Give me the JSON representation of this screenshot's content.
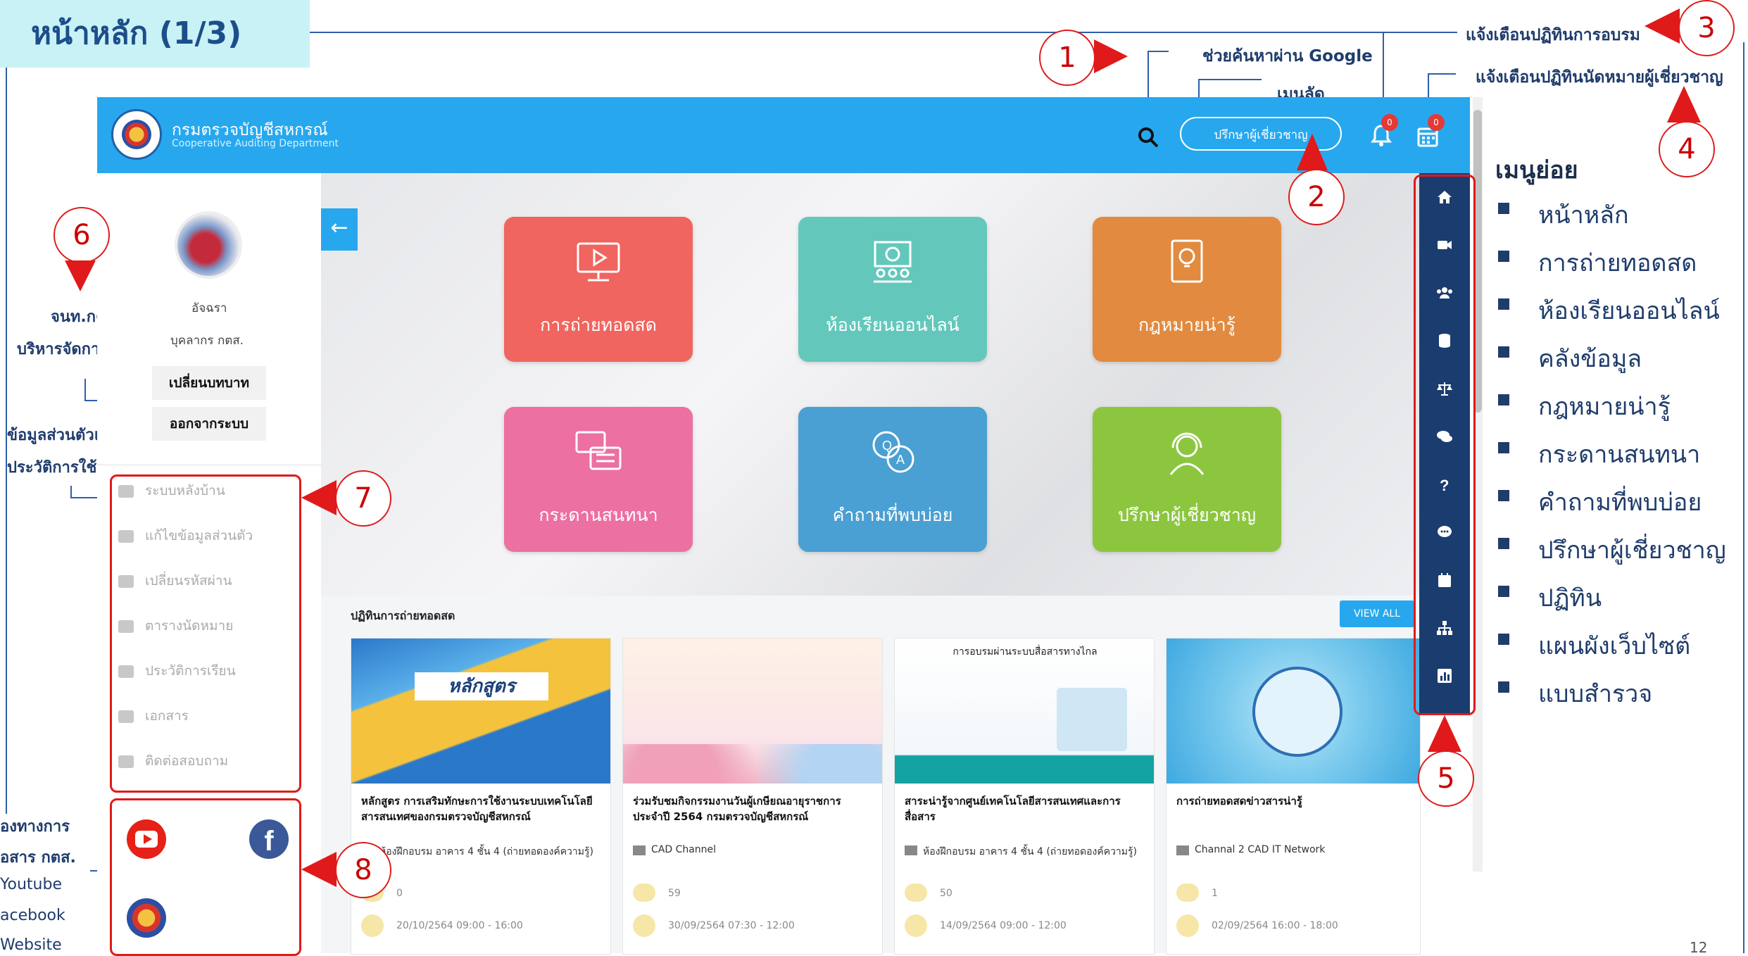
{
  "slide": {
    "title": "หน้าหลัก (1/3)",
    "page_number": "12"
  },
  "annotations": {
    "n1": "1",
    "n2": "2",
    "n3": "3",
    "n4": "4",
    "n5": "5",
    "n6": "6",
    "n7": "7",
    "n8": "8",
    "google_search": "ช่วยค้นหาผ่าน Google",
    "shortcut_menu": "เมนูลัด",
    "training_calendar_alert": "แจ้งเตือนปฏิทินการอบรม",
    "expert_calendar_alert": "แจ้งเตือนปฏิทินนัดหมายผู้เชี่ยวชาญ",
    "staff_line1": "จนท.กตส.",
    "staff_line2": "บริหารจัดการข้อมูล",
    "personal_line1": "ข้อมูลส่วนตัวและ",
    "personal_line2": "ประวัติการใช้งาน",
    "channels_line1": "องทางการ",
    "channels_line2": "อสาร กตส.",
    "channels_line3": "Youtube",
    "channels_line4": "acebook",
    "channels_line5": "Website"
  },
  "header": {
    "dept_th": "กรมตรวจบัญชีสหกรณ์",
    "dept_en": "Cooperative Auditing Department",
    "consult_button": "ปรึกษาผู้เชี่ยวชาญ",
    "bell_badge": "0",
    "calendar_badge": "0"
  },
  "sidebar": {
    "user_name": "อัจฉรา",
    "user_role": "บุคลากร กตส.",
    "switch_role": "เปลี่ยนบทบาท",
    "logout": "ออกจากระบบ",
    "menu": [
      {
        "label": "ระบบหลังบ้าน",
        "icon": "cogs-icon"
      },
      {
        "label": "แก้ไขข้อมูลส่วนตัว",
        "icon": "user-edit-icon"
      },
      {
        "label": "เปลี่ยนรหัสผ่าน",
        "icon": "user-lock-icon"
      },
      {
        "label": "ตารางนัดหมาย",
        "icon": "calendar-check-icon"
      },
      {
        "label": "ประวัติการเรียน",
        "icon": "history-icon"
      },
      {
        "label": "เอกสาร",
        "icon": "file-icon"
      },
      {
        "label": "ติดต่อสอบถาม",
        "icon": "edit-icon"
      }
    ]
  },
  "tiles": [
    {
      "label": "การถ่ายทอดสด",
      "color": "#f0655f",
      "icon": "live-video-icon"
    },
    {
      "label": "ห้องเรียนออนไลน์",
      "color": "#63c8bb",
      "icon": "classroom-icon"
    },
    {
      "label": "กฎหมายน่ารู้",
      "color": "#e28a3f",
      "icon": "law-book-icon"
    },
    {
      "label": "กระดานสนทนา",
      "color": "#ec70a2",
      "icon": "chat-board-icon"
    },
    {
      "label": "คำถามที่พบบ่อย",
      "color": "#4a9fd3",
      "icon": "qa-icon"
    },
    {
      "label": "ปรึกษาผู้เชี่ยวชาญ",
      "color": "#8cc63f",
      "icon": "headset-icon"
    }
  ],
  "live": {
    "section_title": "ปฏิทินการถ่ายทอดสด",
    "view_all": "VIEW ALL",
    "cards": [
      {
        "title": "หลักสูตร การเสริมทักษะการใช้งานระบบเทคโนโลยีสารสนเทศของกรมตรวจบัญชีสหกรณ์",
        "location": "ห้องฝึกอบรม อาคาร 4 ชั้น 4 (ถ่ายทอดองค์ความรู้)",
        "views": "0",
        "datetime": "20/10/2564 09:00 - 16:00",
        "thumb_label": "หลักสูตร"
      },
      {
        "title": "ร่วมรับชมกิจกรรมงานวันผู้เกษียณอายุราชการ ประจำปี 2564 กรมตรวจบัญชีสหกรณ์",
        "location": "CAD Channel",
        "views": "59",
        "datetime": "30/09/2564 07:30 - 12:00",
        "thumb_label": ""
      },
      {
        "title": "สาระน่ารู้จากศูนย์เทคโนโลยีสารสนเทศและการสื่อสาร",
        "location": "ห้องฝึกอบรม อาคาร 4 ชั้น 4 (ถ่ายทอดองค์ความรู้)",
        "views": "50",
        "datetime": "14/09/2564 09:00 - 12:00",
        "thumb_label": "การอบรมผ่านระบบสื่อสารทางไกล"
      },
      {
        "title": "การถ่ายทอดสดข่าวสารน่ารู้",
        "location": "Channal 2 CAD IT Network",
        "views": "1",
        "datetime": "02/09/2564 16:00 - 18:00",
        "thumb_label": ""
      }
    ]
  },
  "rightbar_icons": [
    "home-icon",
    "video-icon",
    "users-icon",
    "database-icon",
    "balance-scale-icon",
    "comments-icon",
    "question-icon",
    "comment-dots-icon",
    "calendar-icon",
    "sitemap-icon",
    "chart-bar-icon"
  ],
  "submenu": {
    "title": "เมนูย่อย",
    "items": [
      "หน้าหลัก",
      "การถ่ายทอดสด",
      "ห้องเรียนออนไลน์",
      "คลังข้อมูล",
      "กฎหมายน่ารู้",
      "กระดานสนทนา",
      "คำถามที่พบบ่อย",
      "ปรึกษาผู้เชี่ยวชาญ",
      "ปฏิทิน",
      "แผนผังเว็บไซต์",
      "แบบสำรวจ"
    ]
  }
}
